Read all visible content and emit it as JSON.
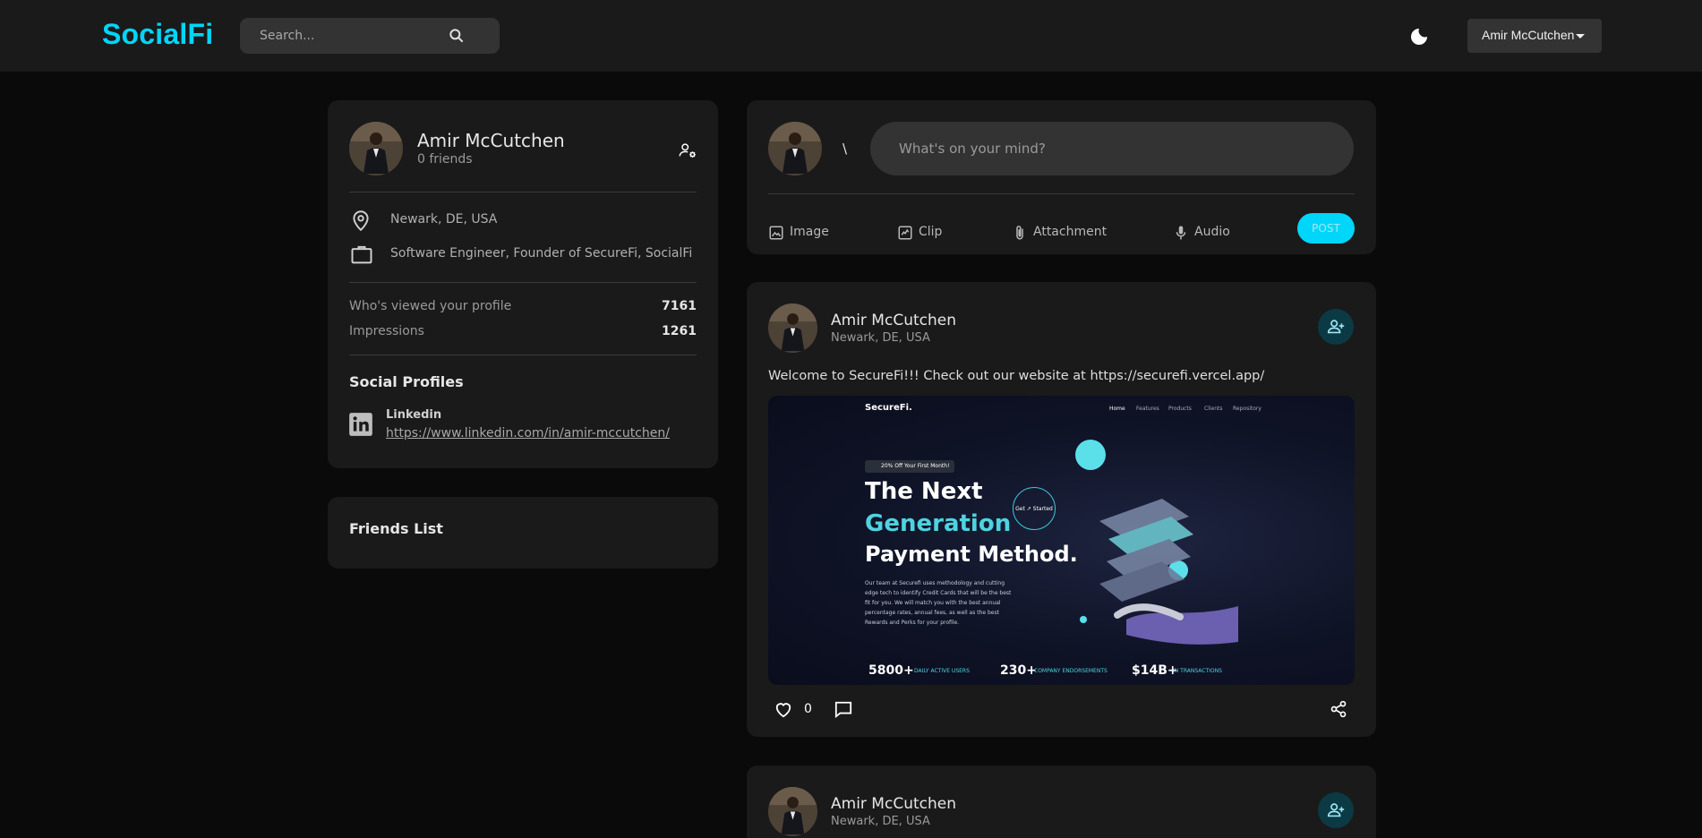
{
  "navbar": {
    "logo": "SocialFi",
    "search_placeholder": "Search...",
    "user_name": "Amir McCutchen",
    "accent": "#00d5fa"
  },
  "profile": {
    "name": "Amir McCutchen",
    "friends": "0 friends",
    "location": "Newark, DE, USA",
    "occupation": "Software Engineer, Founder of SecureFi, SocialFi",
    "stats": [
      {
        "label": "Who's viewed your profile",
        "value": "7161"
      },
      {
        "label": "Impressions",
        "value": "1261"
      }
    ],
    "social_heading": "Social Profiles",
    "social": {
      "name": "Linkedin",
      "url": "https://www.linkedin.com/in/amir-mccutchen/"
    }
  },
  "friends_list": {
    "heading": "Friends List"
  },
  "composer": {
    "slash": "\\",
    "placeholder": "What's on your mind?",
    "tools": [
      "Image",
      "Clip",
      "Attachment",
      "Audio"
    ],
    "post_label": "POST"
  },
  "posts": [
    {
      "name": "Amir McCutchen",
      "location": "Newark, DE, USA",
      "text": "Welcome to SecureFi!!! Check out our website at https://securefi.vercel.app/",
      "likes": "0",
      "preview": {
        "brand": "SecureFi.",
        "nav": [
          "Home",
          "Features",
          "Products",
          "Clients",
          "Repository"
        ],
        "badge": "20% Off Your First Month!",
        "headline_1": "The Next",
        "headline_2": "Generation",
        "headline_3": "Payment Method.",
        "cta": "Get ↗ Started",
        "body": "Our team at Securefi uses methodology and cutting edge tech to identify Credit Cards that will be the best fit for you. We will match you with the best annual percentage rates, annual fees, as well as the best Rewards and Perks for your profile.",
        "stats": [
          {
            "value": "5800+",
            "label": "DAILY ACTIVE USERS"
          },
          {
            "value": "230+",
            "label": "COMPANY ENDORSEMENTS"
          },
          {
            "value": "$14B+",
            "label": "IN TRANSACTIONS"
          }
        ]
      }
    },
    {
      "name": "Amir McCutchen",
      "location": "Newark, DE, USA"
    }
  ]
}
